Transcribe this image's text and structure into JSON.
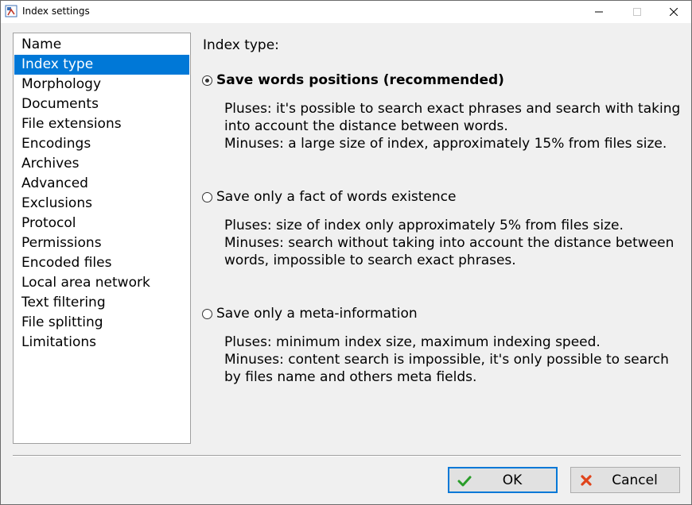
{
  "window": {
    "title": "Index settings"
  },
  "nav": {
    "items": [
      {
        "label": "Name"
      },
      {
        "label": "Index type"
      },
      {
        "label": "Morphology"
      },
      {
        "label": "Documents"
      },
      {
        "label": "File extensions"
      },
      {
        "label": "Encodings"
      },
      {
        "label": "Archives"
      },
      {
        "label": "Advanced"
      },
      {
        "label": "Exclusions"
      },
      {
        "label": "Protocol"
      },
      {
        "label": "Permissions"
      },
      {
        "label": "Encoded files"
      },
      {
        "label": "Local area network"
      },
      {
        "label": "Text filtering"
      },
      {
        "label": "File splitting"
      },
      {
        "label": "Limitations"
      }
    ],
    "selected": "Index type"
  },
  "main": {
    "section_label": "Index type:",
    "options": [
      {
        "label": "Save words positions (recommended)",
        "checked": true,
        "desc": [
          "Pluses: it's possible to search exact phrases and search with taking",
          "into account the distance between words.",
          "Minuses: a large size of index, approximately 15% from files size."
        ]
      },
      {
        "label": "Save only a fact of words existence",
        "checked": false,
        "desc": [
          "Pluses: size of index only approximately 5% from files size.",
          "Minuses: search without taking into account the distance between",
          "words, impossible to search exact phrases."
        ]
      },
      {
        "label": "Save only a meta-information",
        "checked": false,
        "desc": [
          "Pluses: minimum index size, maximum indexing speed.",
          "Minuses: content search is impossible, it's only possible to search",
          "by files name and others meta fields."
        ]
      }
    ]
  },
  "buttons": {
    "ok_label": "OK",
    "cancel_label": "Cancel"
  },
  "colors": {
    "selection": "#0078d7",
    "ok_icon": "#2a9d2a",
    "cancel_icon": "#e0441b"
  }
}
